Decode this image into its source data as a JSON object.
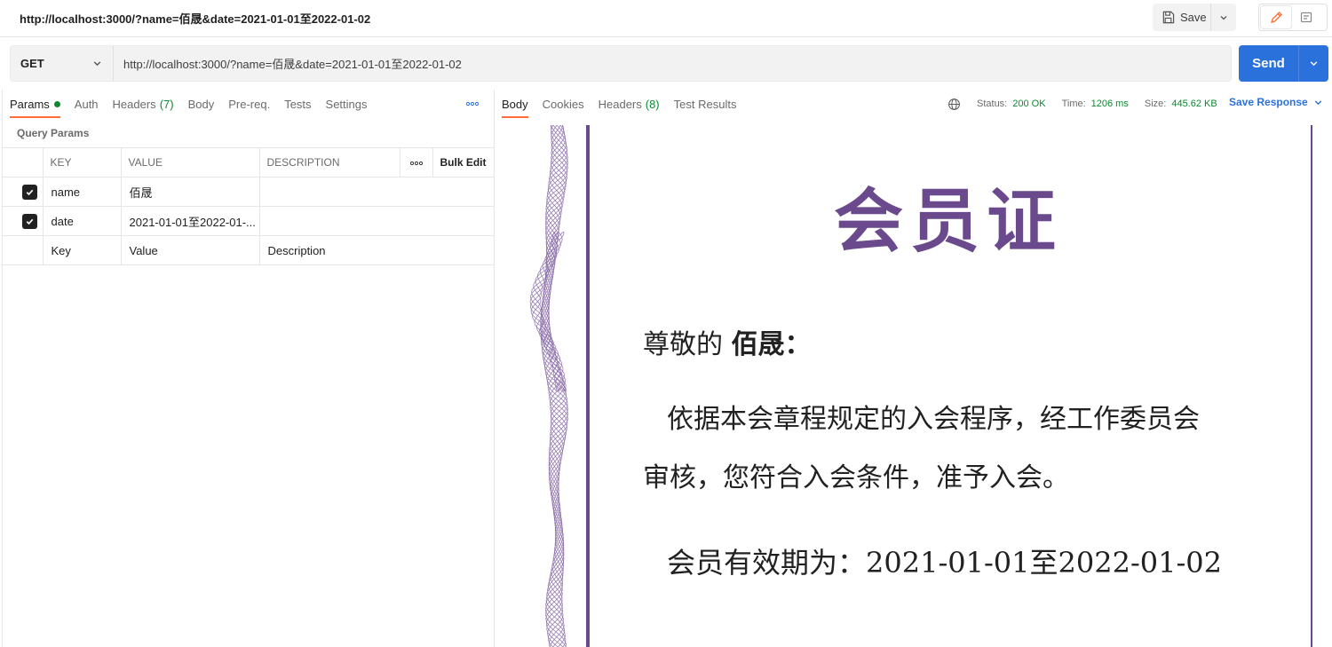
{
  "window": {
    "title": "http://localhost:3000/?name=佰晟&date=2021-01-01至2022-01-02"
  },
  "toolbar": {
    "save_label": "Save"
  },
  "request": {
    "method": "GET",
    "url": "http://localhost:3000/?name=佰晟&date=2021-01-01至2022-01-02",
    "send_label": "Send",
    "tabs": [
      {
        "label": "Params",
        "active": true
      },
      {
        "label": "Auth"
      },
      {
        "label": "Headers",
        "count": "(7)"
      },
      {
        "label": "Body"
      },
      {
        "label": "Pre-req."
      },
      {
        "label": "Tests"
      },
      {
        "label": "Settings"
      }
    ]
  },
  "query_params": {
    "label": "Query Params",
    "headers": {
      "key": "KEY",
      "value": "VALUE",
      "description": "DESCRIPTION",
      "bulk_edit": "Bulk Edit"
    },
    "rows": [
      {
        "checked": true,
        "key": "name",
        "value": "佰晟",
        "description": ""
      },
      {
        "checked": true,
        "key": "date",
        "value": "2021-01-01至2022-01-...",
        "description": ""
      }
    ],
    "placeholder": {
      "key": "Key",
      "value": "Value",
      "description": "Description"
    }
  },
  "response": {
    "tabs": [
      {
        "label": "Body",
        "active": true
      },
      {
        "label": "Cookies"
      },
      {
        "label": "Headers",
        "count": "(8)"
      },
      {
        "label": "Test Results"
      }
    ],
    "status_label": "Status:",
    "status_value": "200 OK",
    "time_label": "Time:",
    "time_value": "1206 ms",
    "size_label": "Size:",
    "size_value": "445.62 KB",
    "save_response_label": "Save Response"
  },
  "certificate": {
    "title": "会员证",
    "greeting": "尊敬的",
    "name": "佰晟：",
    "body_line1": "依据本会章程规定的入会程序，经工作委员会",
    "body_line2": "审核，您符合入会条件，准予入会。",
    "validity": "会员有效期为：2021-01-01至2022-01-02"
  },
  "colors": {
    "accent": "#ff6c37",
    "primary": "#2b71dc",
    "success": "#0a8a2f",
    "cert_purple": "#6a4a8d"
  }
}
